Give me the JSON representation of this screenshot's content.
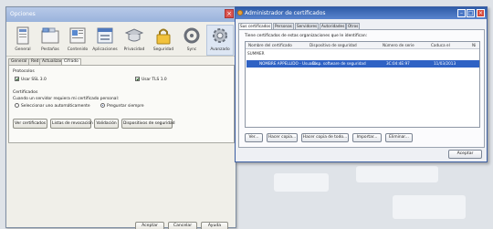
{
  "options_window": {
    "title": "Opciones",
    "toolbar": [
      {
        "label": "General",
        "icon": "general-icon"
      },
      {
        "label": "Pestañas",
        "icon": "tabs-icon"
      },
      {
        "label": "Contenido",
        "icon": "content-icon"
      },
      {
        "label": "Aplicaciones",
        "icon": "applications-icon"
      },
      {
        "label": "Privacidad",
        "icon": "privacy-icon"
      },
      {
        "label": "Seguridad",
        "icon": "security-icon"
      },
      {
        "label": "Sync",
        "icon": "sync-icon"
      },
      {
        "label": "Avanzado",
        "icon": "advanced-icon",
        "selected": true
      }
    ],
    "subtabs": [
      "General",
      "Red",
      "Actualizar",
      "Cifrado"
    ],
    "active_subtab": "Cifrado",
    "protocols": {
      "heading": "Protocolos",
      "ssl": "Usar SSL 3.0",
      "tls": "Usar TLS 1.0"
    },
    "certificates": {
      "heading": "Certificados",
      "question": "Cuando un servidor requiera mi certificado personal:",
      "opt_auto": "Seleccionar uno automáticamente",
      "opt_ask": "Preguntar siempre",
      "buttons": [
        "Ver certificados",
        "Listas de revocación",
        "Validación",
        "Dispositivos de seguridad"
      ]
    },
    "footer": {
      "accept": "Aceptar",
      "cancel": "Cancelar",
      "help": "Ayuda"
    }
  },
  "cert_manager": {
    "title": "Administrador de certificados",
    "tabs": [
      "Sus certificados",
      "Personas",
      "Servidores",
      "Autoridades",
      "Otros"
    ],
    "description": "Tiene certificados de estas organizaciones que le identifican:",
    "columns": [
      "Nombre del certificado",
      "Dispositivo de seguridad",
      "Número de serie",
      "Caduca el",
      "Ni"
    ],
    "group": "SUMMER",
    "row": {
      "name": "NOMBRE APPELLIDO - Usuario...",
      "device": "Disp. software de seguridad",
      "serial": "3C:04:4E:97",
      "expires": "11/03/2013"
    },
    "buttons": [
      "Ver...",
      "Hacer copia...",
      "Hacer copia de todo...",
      "Importar...",
      "Eliminar..."
    ],
    "accept": "Aceptar"
  }
}
